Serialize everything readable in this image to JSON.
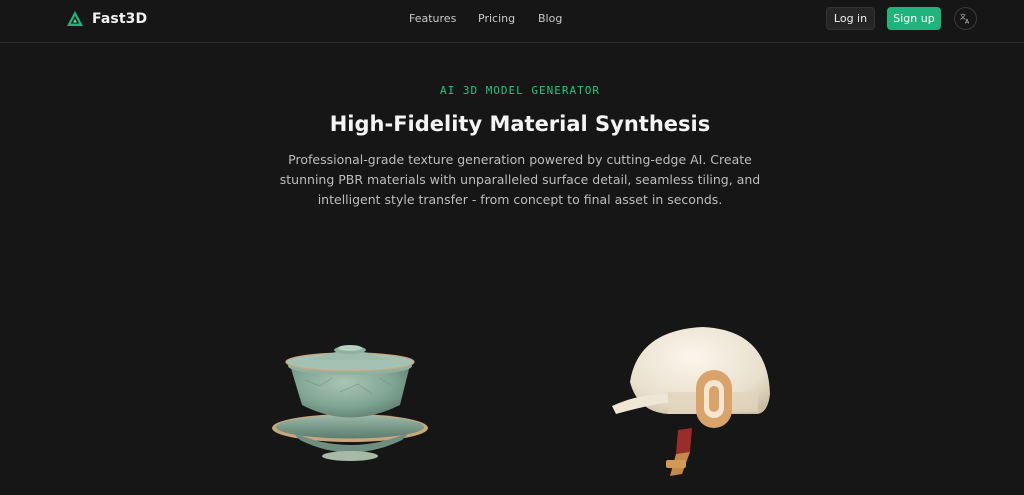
{
  "header": {
    "brand_name": "Fast3D",
    "nav": [
      {
        "label": "Features"
      },
      {
        "label": "Pricing"
      },
      {
        "label": "Blog"
      }
    ],
    "login_label": "Log in",
    "signup_label": "Sign up",
    "lang_icon": "translate-icon"
  },
  "hero": {
    "eyebrow": "AI 3D MODEL GENERATOR",
    "title": "High-Fidelity Material Synthesis",
    "subtitle": "Professional-grade texture generation powered by cutting-edge AI. Create stunning PBR materials with unparalleled surface detail, seamless tiling, and intelligent style transfer - from concept to final asset in seconds."
  },
  "showcase": [
    {
      "icon": "celadon-teacup-model"
    },
    {
      "icon": "helmet-model"
    }
  ],
  "colors": {
    "background": "#161616",
    "accent": "#1fb47d",
    "eyebrow": "#23c483"
  }
}
